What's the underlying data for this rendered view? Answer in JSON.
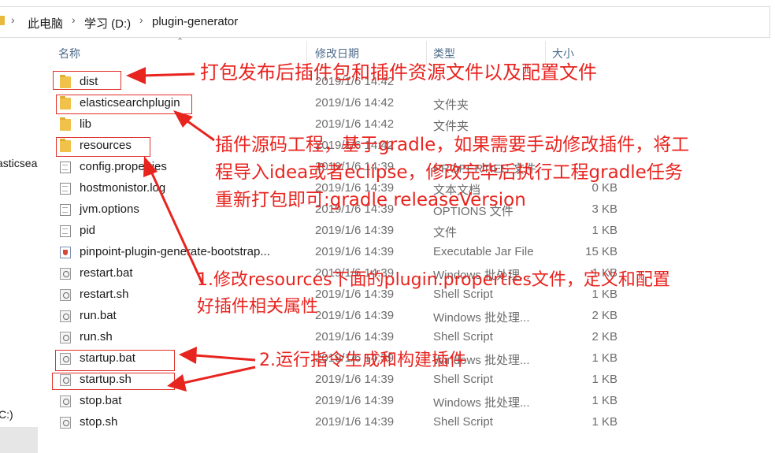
{
  "breadcrumb": {
    "items": [
      "此电脑",
      "学习 (D:)",
      "plugin-generator"
    ],
    "separator": "›"
  },
  "nav": {
    "partial_item": "asticsea",
    "partial_drive": "C:)"
  },
  "columns": {
    "name": "名称",
    "date": "修改日期",
    "type": "类型",
    "size": "大小"
  },
  "files": [
    {
      "name": "dist",
      "date": "2019/1/6 14:42",
      "type": "",
      "size": "",
      "icon": "folder-icon"
    },
    {
      "name": "elasticsearchplugin",
      "date": "2019/1/6 14:42",
      "type": "文件夹",
      "size": "",
      "icon": "folder-icon"
    },
    {
      "name": "lib",
      "date": "2019/1/6 14:42",
      "type": "文件夹",
      "size": "",
      "icon": "folder-icon"
    },
    {
      "name": "resources",
      "date": "2019/1/6 14:42",
      "type": "",
      "size": "",
      "icon": "folder-icon"
    },
    {
      "name": "config.properties",
      "date": "2019/1/6 14:39",
      "type": "PROPERTIES 文件",
      "size": "",
      "icon": "document-icon"
    },
    {
      "name": "hostmonistor.log",
      "date": "2019/1/6 14:39",
      "type": "文本文档",
      "size": "0 KB",
      "icon": "document-icon"
    },
    {
      "name": "jvm.options",
      "date": "2019/1/6 14:39",
      "type": "OPTIONS 文件",
      "size": "3 KB",
      "icon": "document-icon"
    },
    {
      "name": "pid",
      "date": "2019/1/6 14:39",
      "type": "文件",
      "size": "1 KB",
      "icon": "document-icon"
    },
    {
      "name": "pinpoint-plugin-generate-bootstrap...",
      "date": "2019/1/6 14:39",
      "type": "Executable Jar File",
      "size": "15 KB",
      "icon": "jar-icon"
    },
    {
      "name": "restart.bat",
      "date": "2019/1/6 14:39",
      "type": "Windows 批处理...",
      "size": "1 KB",
      "icon": "script-icon"
    },
    {
      "name": "restart.sh",
      "date": "2019/1/6 14:39",
      "type": "Shell Script",
      "size": "1 KB",
      "icon": "script-icon"
    },
    {
      "name": "run.bat",
      "date": "2019/1/6 14:39",
      "type": "Windows 批处理...",
      "size": "2 KB",
      "icon": "script-icon"
    },
    {
      "name": "run.sh",
      "date": "2019/1/6 14:39",
      "type": "Shell Script",
      "size": "2 KB",
      "icon": "script-icon"
    },
    {
      "name": "startup.bat",
      "date": "2019/1/6 14:39",
      "type": "Windows 批处理...",
      "size": "1 KB",
      "icon": "script-icon"
    },
    {
      "name": "startup.sh",
      "date": "2019/1/6 14:39",
      "type": "Shell Script",
      "size": "1 KB",
      "icon": "script-icon"
    },
    {
      "name": "stop.bat",
      "date": "2019/1/6 14:39",
      "type": "Windows 批处理...",
      "size": "1 KB",
      "icon": "script-icon"
    },
    {
      "name": "stop.sh",
      "date": "2019/1/6 14:39",
      "type": "Shell Script",
      "size": "1 KB",
      "icon": "script-icon"
    }
  ],
  "annotations": {
    "dist_note": "打包发布后插件包和插件资源文件以及配置文件",
    "plugin_note_1": "插件源码工程，基于gradle，如果需要手动修改插件，将工",
    "plugin_note_2": "程导入idea或者eclipse，修改完毕后执行工程gradle任务",
    "plugin_note_3": "重新打包即可:gradle releaseVersion",
    "step1_line1": "1.修改resources下面的plugin.properties文件，定义和配置",
    "step1_line2": "好插件相关属性",
    "step2": "2.运行指令生成和构建插件",
    "color": "#e8241f"
  }
}
